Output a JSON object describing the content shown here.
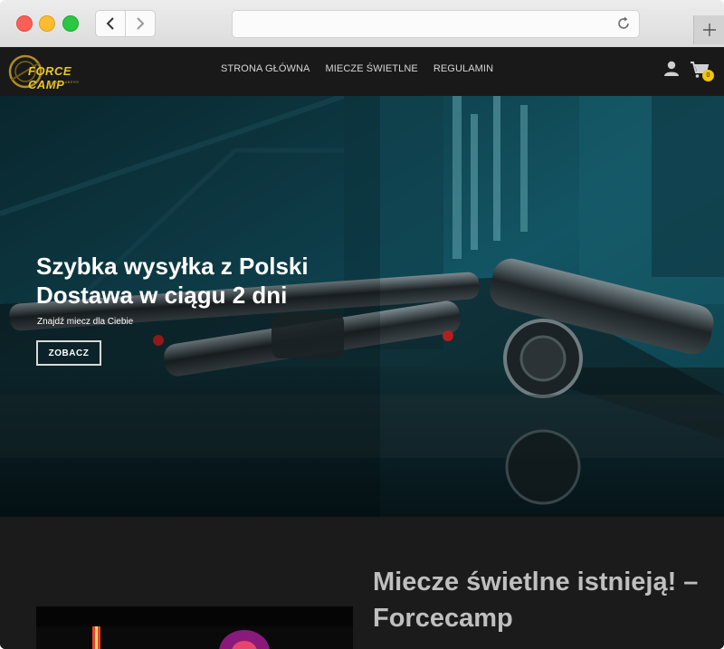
{
  "browser": {
    "address": ""
  },
  "header": {
    "logo_text": "FORCE CAMP",
    "logo_subtext": "LIGHTSABERS",
    "nav": [
      {
        "label": "STRONA GŁÓWNA"
      },
      {
        "label": "MIECZE ŚWIETLNE"
      },
      {
        "label": "REGULAMIN"
      }
    ],
    "cart_count": "0"
  },
  "hero": {
    "title": "Szybka wysyłka z Polski Dostawa w ciągu 2 dni",
    "subtitle": "Znajdź miecz dla Ciebie",
    "button_label": "ZOBACZ"
  },
  "section": {
    "title": "Miecze świetlne istnieją! – Forcecamp"
  },
  "colors": {
    "accent": "#f1c40f",
    "header_bg": "#191919",
    "page_bg": "#1b1b1b",
    "hero_teal": "#0f4a58"
  }
}
